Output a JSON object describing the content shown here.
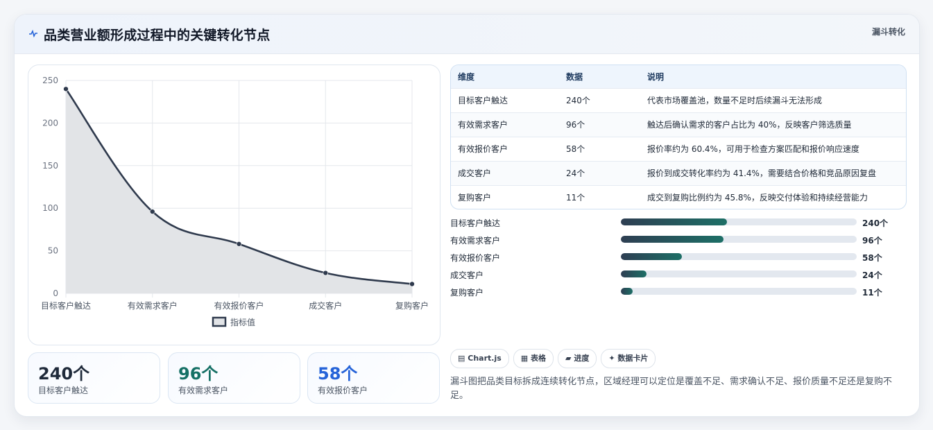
{
  "header": {
    "title": "品类营业额形成过程中的关键转化节点",
    "badge": "漏斗转化",
    "icon": "pulse-icon"
  },
  "chart_data": {
    "type": "line",
    "categories": [
      "目标客户触达",
      "有效需求客户",
      "有效报价客户",
      "成交客户",
      "复购客户"
    ],
    "series": [
      {
        "name": "指标值",
        "values": [
          240,
          96,
          58,
          24,
          11
        ]
      }
    ],
    "ylim": [
      0,
      250
    ],
    "yticks": [
      0,
      50,
      100,
      150,
      200,
      250
    ],
    "grid": true,
    "fill": true,
    "legend_position": "bottom",
    "colors": {
      "line": "#2f3a4d",
      "fill": "#e2e4e7"
    }
  },
  "stats": [
    {
      "value": "240个",
      "label": "目标客户触达",
      "color": "#1f2a3a"
    },
    {
      "value": "96个",
      "label": "有效需求客户",
      "color": "#157065"
    },
    {
      "value": "58个",
      "label": "有效报价客户",
      "color": "#2563d8"
    }
  ],
  "table": {
    "headers": [
      "维度",
      "数据",
      "说明"
    ],
    "rows": [
      [
        "目标客户触达",
        "240个",
        "代表市场覆盖池，数量不足时后续漏斗无法形成"
      ],
      [
        "有效需求客户",
        "96个",
        "触达后确认需求的客户占比为 40%，反映客户筛选质量"
      ],
      [
        "有效报价客户",
        "58个",
        "报价率约为 60.4%，可用于检查方案匹配和报价响应速度"
      ],
      [
        "成交客户",
        "24个",
        "报价到成交转化率约为 41.4%，需要结合价格和竞品原因复盘"
      ],
      [
        "复购客户",
        "11个",
        "成交到复购比例约为 45.8%，反映交付体验和持续经营能力"
      ]
    ]
  },
  "progress": [
    {
      "label": "目标客户触达",
      "value": "240个",
      "fraction": 0.45
    },
    {
      "label": "有效需求客户",
      "value": "96个",
      "fraction": 0.435
    },
    {
      "label": "有效报价客户",
      "value": "58个",
      "fraction": 0.26
    },
    {
      "label": "成交客户",
      "value": "24个",
      "fraction": 0.108
    },
    {
      "label": "复购客户",
      "value": "11个",
      "fraction": 0.05
    }
  ],
  "tags": [
    {
      "icon": "chart-icon",
      "glyph": "▤",
      "label": "Chart.js"
    },
    {
      "icon": "table-icon",
      "glyph": "▦",
      "label": "表格"
    },
    {
      "icon": "progress-icon",
      "glyph": "▰",
      "label": "进度"
    },
    {
      "icon": "card-icon",
      "glyph": "✦",
      "label": "数据卡片"
    }
  ],
  "note": "漏斗图把品类目标拆成连续转化节点，区域经理可以定位是覆盖不足、需求确认不足、报价质量不足还是复购不足。"
}
